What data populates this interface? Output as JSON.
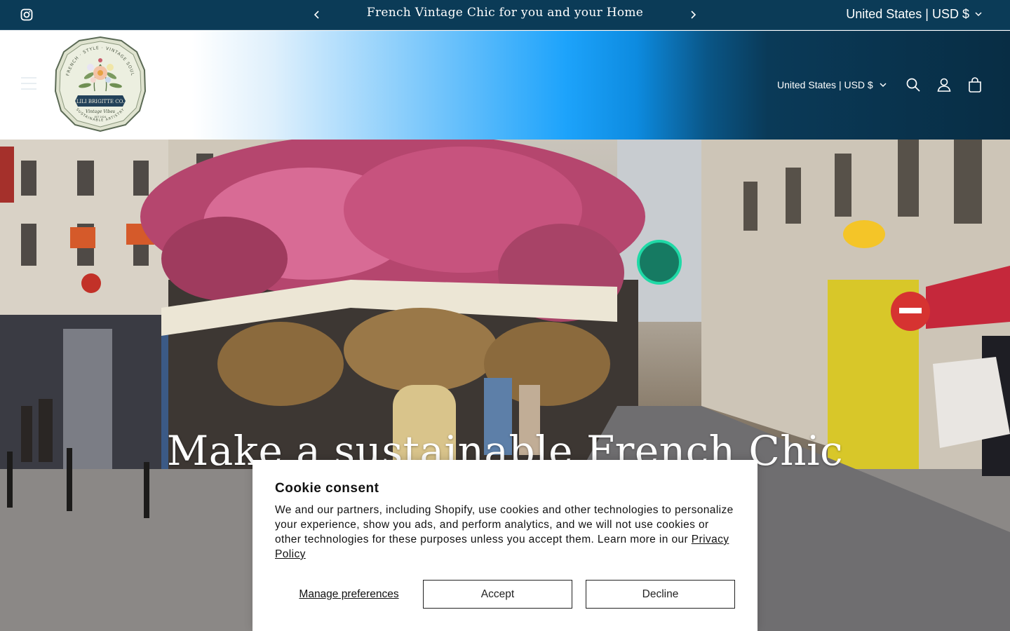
{
  "announcement": {
    "message": "French Vintage Chic for you and your Home",
    "prev_icon": "chevron-left-icon",
    "next_icon": "chevron-right-icon",
    "social_icon": "instagram-icon",
    "country_selector": "United States | USD $"
  },
  "header": {
    "menu_icon": "hamburger-icon",
    "logo": {
      "lines": [
        "FRENCH · STYLE · VINTAGE SOUL",
        "LILI BRIGITTE CO.",
        "Vintage Vibes",
        "EST 2024",
        "SUSTAINABLE ARTISTRY"
      ]
    },
    "country_selector": "United States | USD $",
    "icons": [
      "search-icon",
      "account-icon",
      "cart-icon"
    ]
  },
  "hero": {
    "headline": "Make a sustainable French Chic"
  },
  "cookie_banner": {
    "title": "Cookie consent",
    "body": "We and our partners, including Shopify, use cookies and other technologies to personalize your experience, show you ads, and perform analytics, and we will not use cookies or other technologies for these purposes unless you accept them. Learn more in our ",
    "link_label": "Privacy Policy",
    "manage_label": "Manage preferences",
    "accept_label": "Accept",
    "decline_label": "Decline"
  },
  "colors": {
    "announcement_bg": "#0b3b57",
    "header_gradient_accent": "#1da3fb",
    "header_gradient_dark": "#082d44"
  }
}
